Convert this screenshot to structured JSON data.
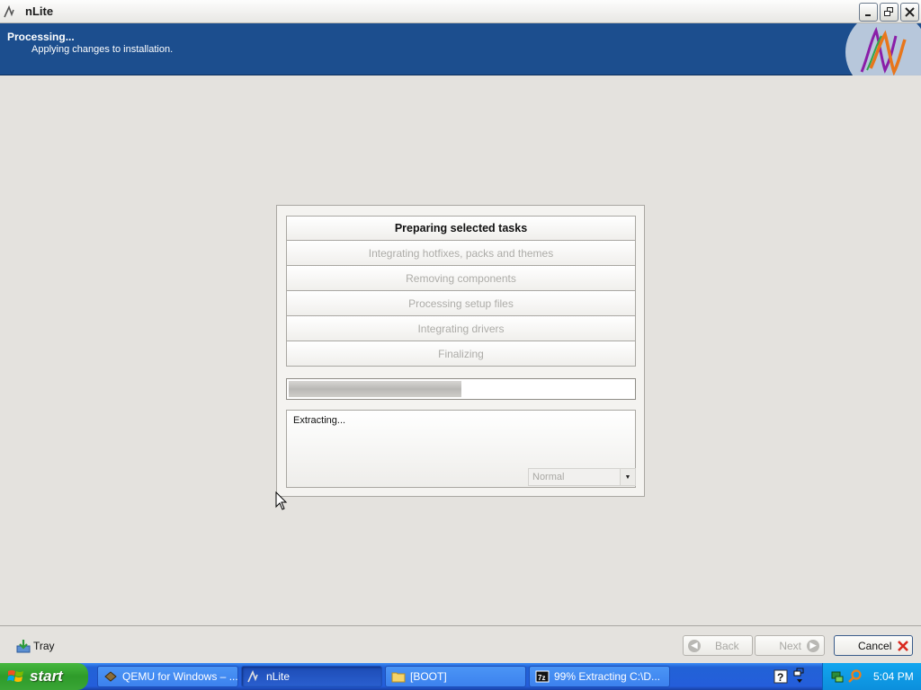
{
  "window": {
    "title": "nLite",
    "minimize_icon": "minimize-icon",
    "restore_icon": "restore-icon",
    "close_icon": "close-icon"
  },
  "header": {
    "title": "Processing...",
    "subtitle": "Applying changes to installation."
  },
  "tasks": [
    {
      "label": "Preparing selected tasks",
      "state": "active"
    },
    {
      "label": "Integrating hotfixes, packs and themes",
      "state": "pending"
    },
    {
      "label": "Removing components",
      "state": "pending"
    },
    {
      "label": "Processing setup files",
      "state": "pending"
    },
    {
      "label": "Integrating drivers",
      "state": "pending"
    },
    {
      "label": "Finalizing",
      "state": "pending"
    }
  ],
  "progress": {
    "percent": 50
  },
  "log": {
    "text": "Extracting...",
    "priority_value": "Normal"
  },
  "bottom": {
    "tray_label": "Tray",
    "back_label": "Back",
    "next_label": "Next",
    "cancel_label": "Cancel"
  },
  "taskbar": {
    "start_label": "start",
    "items": [
      {
        "label": "QEMU for Windows – ...",
        "icon": "qemu-icon",
        "active": false
      },
      {
        "label": "nLite",
        "icon": "nlite-icon",
        "active": true
      },
      {
        "label": "[BOOT]",
        "icon": "folder-icon",
        "active": false
      },
      {
        "label": "99% Extracting C:\\D...",
        "icon": "7zip-icon",
        "active": false
      }
    ],
    "clock": "5:04 PM"
  },
  "colors": {
    "header_bg": "#1c4e8e",
    "taskbar_bg": "#245edb",
    "start_green": "#3aa536",
    "cancel_x": "#d9281e"
  }
}
